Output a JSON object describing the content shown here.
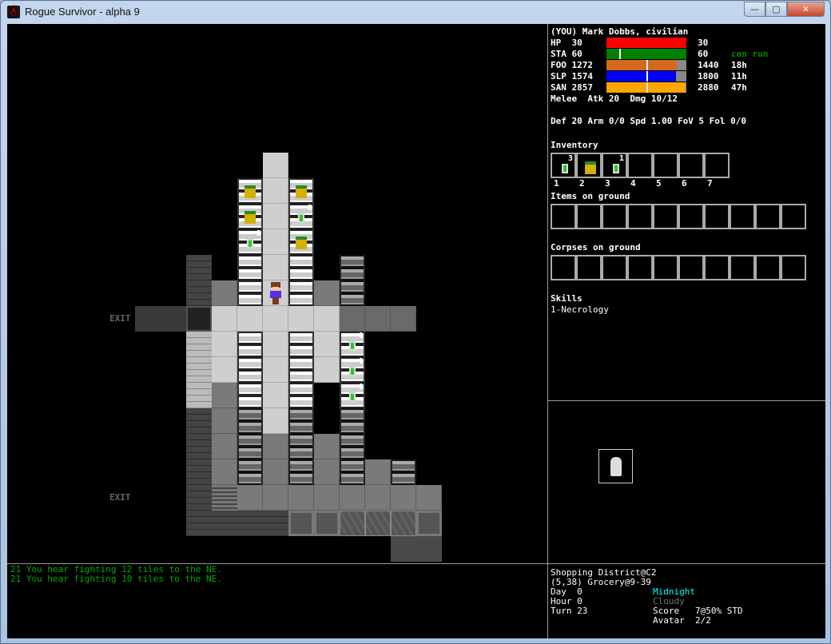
{
  "window": {
    "title": "Rogue Survivor - alpha 9",
    "min": "—",
    "max": "▢",
    "close": "✕"
  },
  "player": {
    "name": "(YOU) Mark Dobbs, civilian"
  },
  "stats": [
    {
      "label": "HP  30",
      "max": "30",
      "extra": "",
      "fill": 1.0,
      "marker": 0,
      "color": "#ff0000"
    },
    {
      "label": "STA 60",
      "max": "60",
      "extra": "can run",
      "fill": 1.0,
      "marker": 0.16,
      "color": "#008000"
    },
    {
      "label": "FOO 1272",
      "max": "1440",
      "extra": "18h",
      "fill": 0.88,
      "marker": 0.5,
      "color": "#d2691e"
    },
    {
      "label": "SLP 1574",
      "max": "1800",
      "extra": "11h",
      "fill": 0.87,
      "marker": 0.5,
      "color": "#0000ff"
    },
    {
      "label": "SAN 2857",
      "max": "2880",
      "extra": "47h",
      "fill": 0.99,
      "marker": 0.5,
      "color": "#ffa500"
    }
  ],
  "combat": {
    "melee": "Melee  Atk 20  Dmg 10/12",
    "defense": "Def 20 Arm 0/0 Spd 1.00 FoV 5 Fol 0/0"
  },
  "inventory": {
    "title": "Inventory",
    "slots": [
      {
        "num": "1",
        "item": "bottle",
        "qty": "3"
      },
      {
        "num": "2",
        "item": "bag",
        "qty": ""
      },
      {
        "num": "3",
        "item": "bottle",
        "qty": "1"
      },
      {
        "num": "4",
        "item": "",
        "qty": ""
      },
      {
        "num": "5",
        "item": "",
        "qty": ""
      },
      {
        "num": "6",
        "item": "",
        "qty": ""
      },
      {
        "num": "7",
        "item": "",
        "qty": ""
      }
    ]
  },
  "ground": {
    "title": "Items on ground",
    "count": 10
  },
  "corpses": {
    "title": "Corpses on ground",
    "count": 10
  },
  "skills": {
    "title": "Skills",
    "list": "1-Necrology"
  },
  "messages": [
    "21 You hear fighting 12 tiles to the NE.",
    "21 You hear fighting 10 tiles to the NE."
  ],
  "location": {
    "district": "Shopping District@C2",
    "position": "(5,38) Grocery@9-39",
    "day": "Day  0",
    "hour": "Hour 0",
    "turn": "Turn 23",
    "time": "Midnight",
    "weather": "Cloudy",
    "score": "Score   7@50% STD",
    "avatar": "Avatar  2/2"
  },
  "map": {
    "exit_label": "EXIT",
    "rows": [
      "     L      ",
      "    SLS     ",
      "    SLS     ",
      "    SLS     ",
      "  W SLS s   ",
      "  WDSLSDs   ",
      "EEGLLLLLKKK ",
      "  wLSLSLS   ",
      "  wLSLSLS   ",
      "  wDSLS S   ",
      "  WDsLs s   ",
      "  WDsDsDs   ",
      "  WDsDsDsDs ",
      "  WTDDDDDDDD",
      "  WWWWPPgggP",
      "          dd"
    ],
    "items": [
      {
        "r": 1,
        "c": 4,
        "type": "bag",
        "qty": ""
      },
      {
        "r": 1,
        "c": 6,
        "type": "bag",
        "qty": ""
      },
      {
        "r": 2,
        "c": 4,
        "type": "bag",
        "qty": ""
      },
      {
        "r": 2,
        "c": 6,
        "type": "bottle",
        "qty": "2"
      },
      {
        "r": 3,
        "c": 4,
        "type": "bottle",
        "qty": "2"
      },
      {
        "r": 3,
        "c": 6,
        "type": "bag",
        "qty": ""
      },
      {
        "r": 7,
        "c": 8,
        "type": "bottle",
        "qty": "1"
      },
      {
        "r": 8,
        "c": 8,
        "type": "bottle",
        "qty": "1"
      },
      {
        "r": 9,
        "c": 8,
        "type": "bottle",
        "qty": "1"
      }
    ],
    "player": {
      "r": 5,
      "c": 5
    },
    "exits": [
      6,
      13
    ]
  }
}
